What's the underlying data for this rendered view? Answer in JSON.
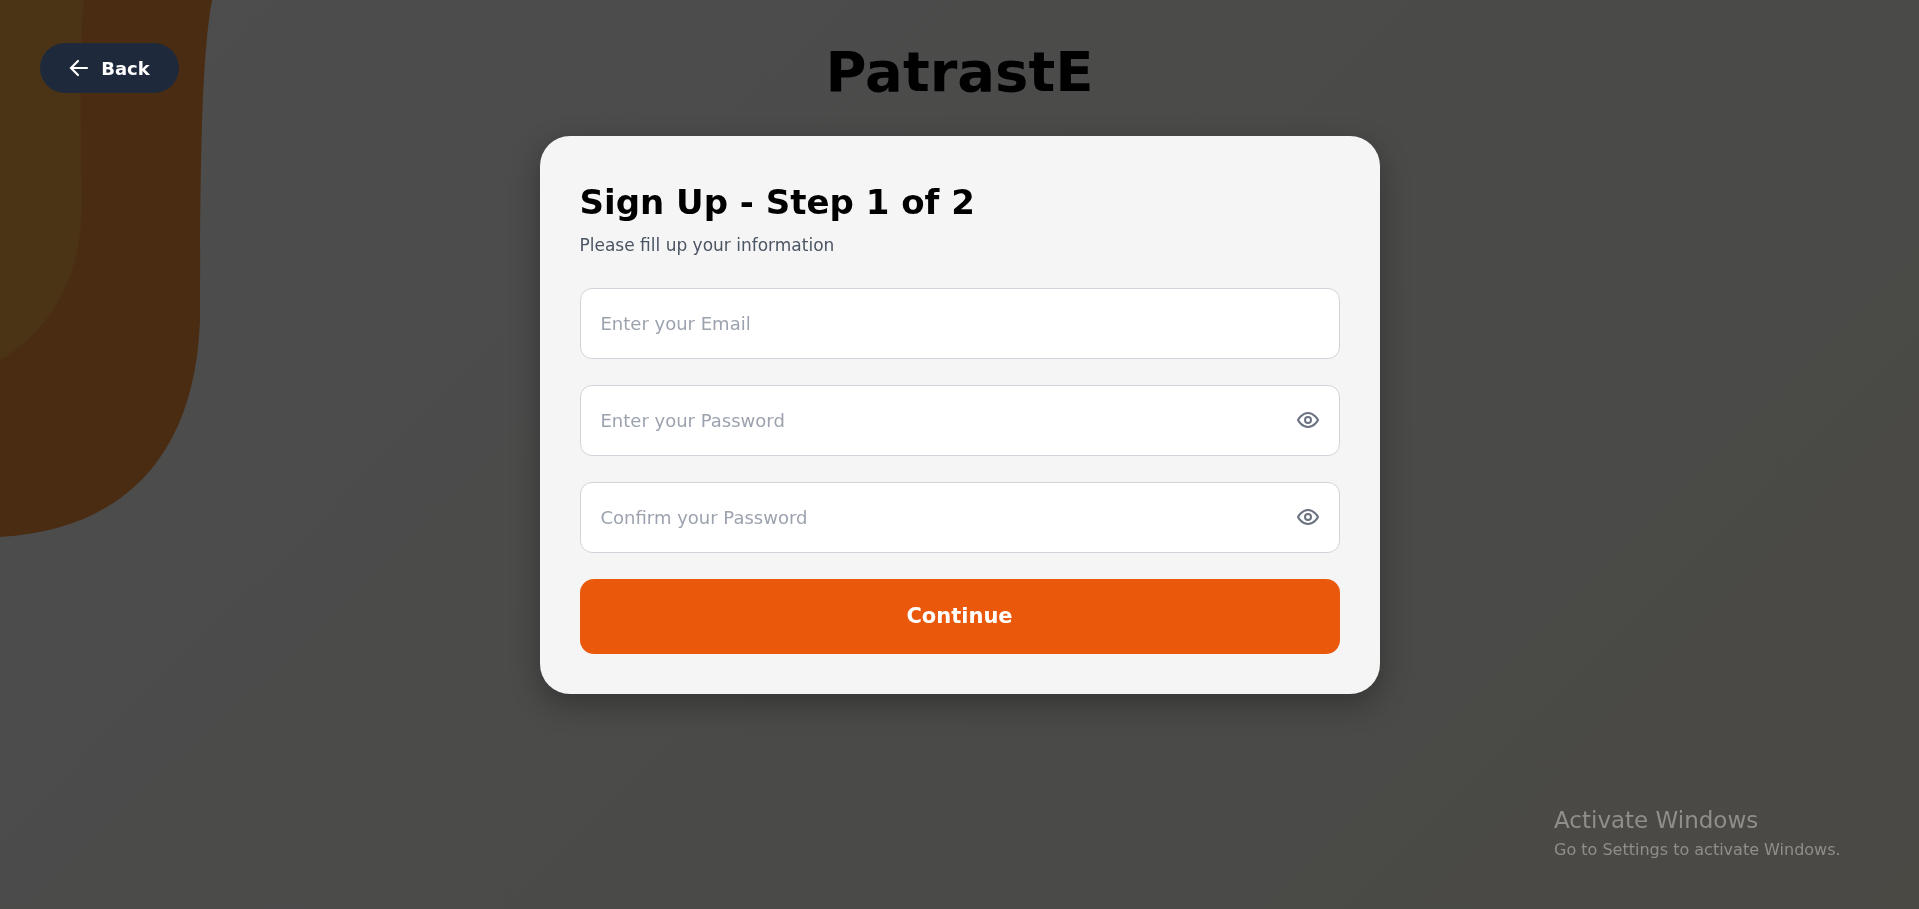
{
  "back_button": {
    "label": "Back"
  },
  "brand": "PatrastE",
  "form": {
    "title": "Sign Up - Step 1 of 2",
    "subtitle": "Please fill up your information",
    "fields": [
      {
        "placeholder": "Enter your Email",
        "reveal_toggle": false
      },
      {
        "placeholder": "Enter your Password",
        "reveal_toggle": true
      },
      {
        "placeholder": "Confirm your Password",
        "reveal_toggle": true
      }
    ],
    "submit": "Continue"
  },
  "os_notice": {
    "title": "Activate Windows",
    "text": "Go to Settings to activate Windows."
  }
}
